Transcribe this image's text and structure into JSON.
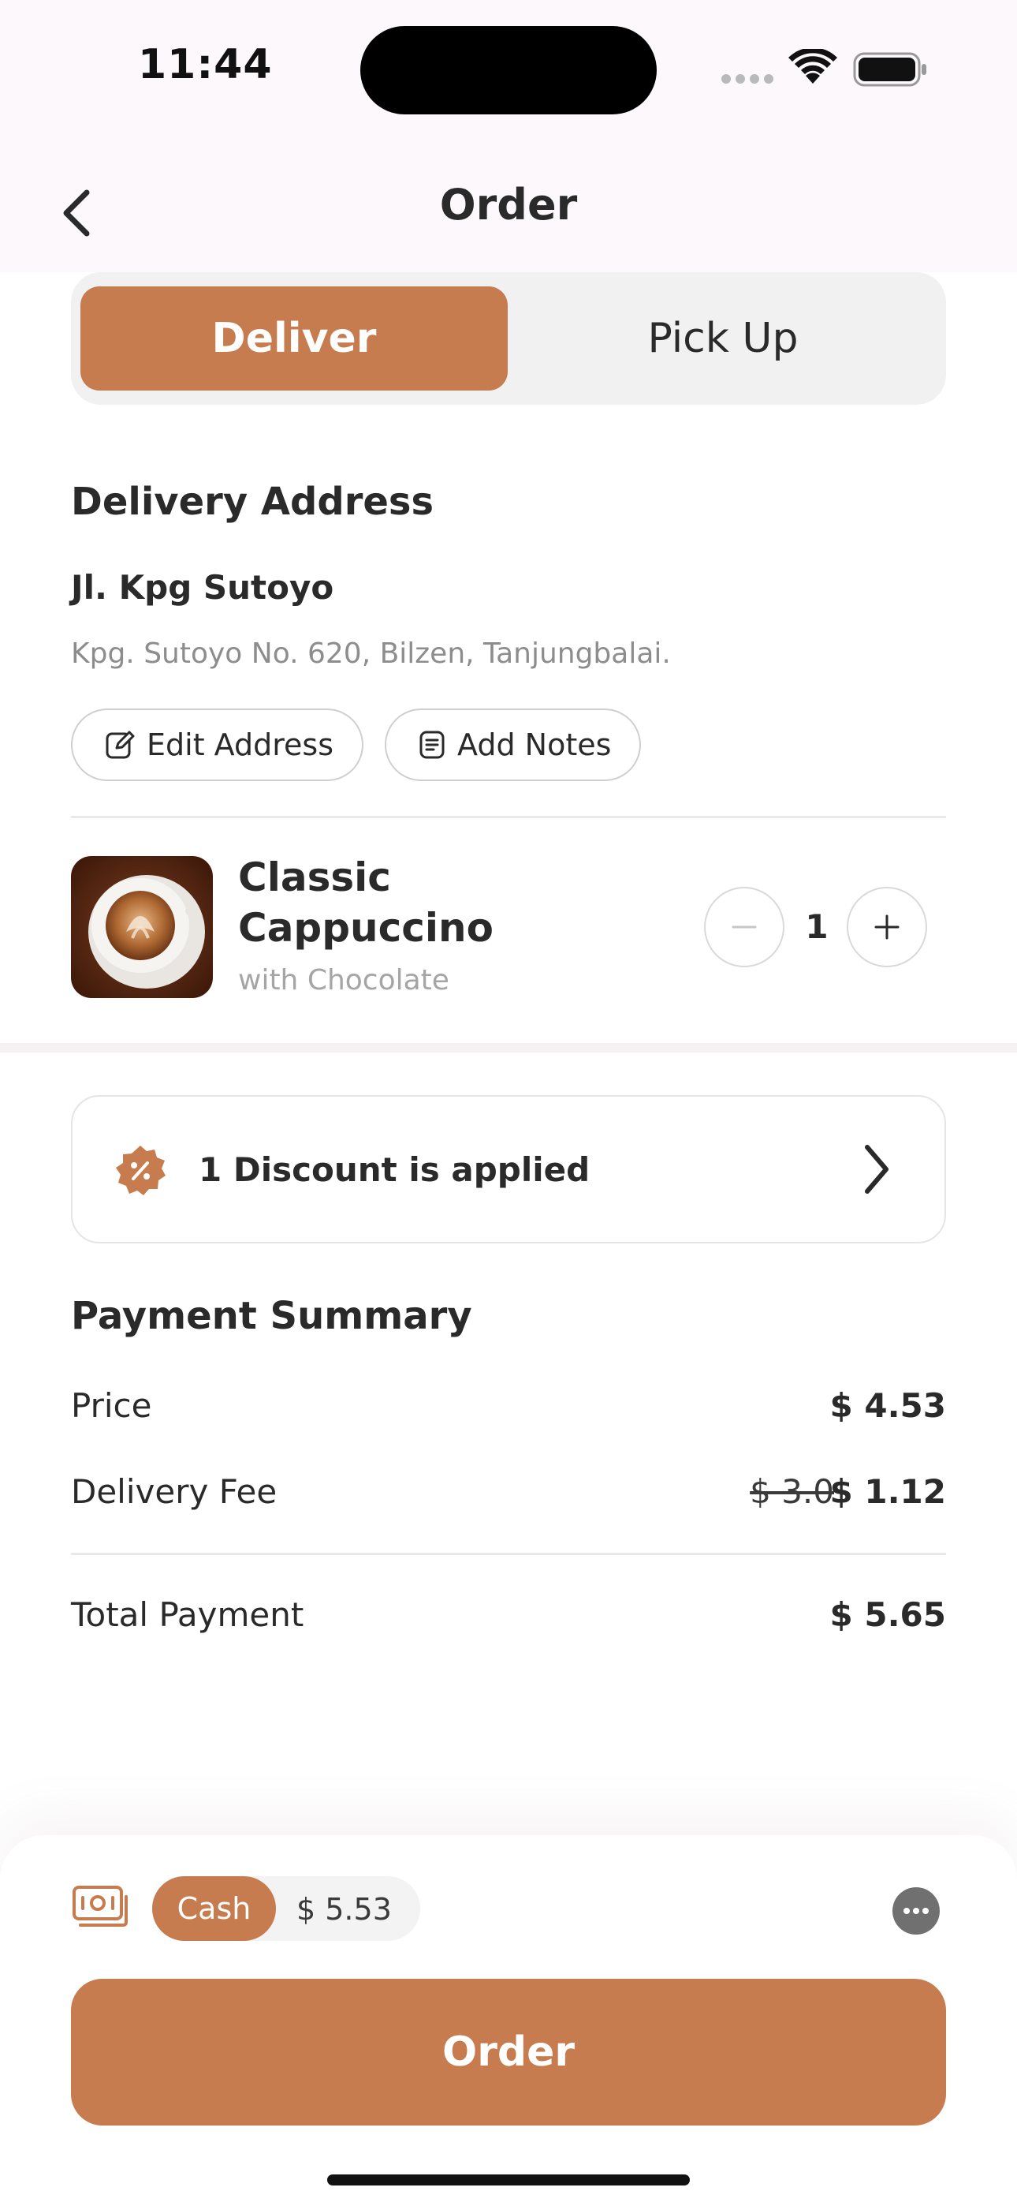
{
  "status_bar": {
    "time": "11:44"
  },
  "header": {
    "title": "Order"
  },
  "toggle": {
    "deliver_label": "Deliver",
    "pickup_label": "Pick Up"
  },
  "delivery": {
    "section_title": "Delivery Address",
    "address_name": "Jl. Kpg Sutoyo",
    "address_detail": "Kpg. Sutoyo No. 620, Bilzen, Tanjungbalai.",
    "edit_label": "Edit Address",
    "notes_label": "Add Notes"
  },
  "product": {
    "name": "Classic Cappuccino",
    "subtitle": "with Chocolate",
    "quantity": "1"
  },
  "discount": {
    "label": "1 Discount is applied"
  },
  "summary": {
    "title": "Payment Summary",
    "price_label": "Price",
    "price_value": "$ 4.53",
    "delivery_label": "Delivery Fee",
    "delivery_old": "$ 3.0",
    "delivery_value": "$ 1.12",
    "total_label": "Total Payment",
    "total_value": "$ 5.65"
  },
  "payment": {
    "method": "Cash",
    "amount": "$ 5.53"
  },
  "order_button": {
    "label": "Order"
  },
  "colors": {
    "accent": "#c67c4e",
    "header_bg": "#fdf8fb",
    "text": "#2a2a2a",
    "muted": "#8d8d8d"
  },
  "icons": [
    "back-icon",
    "wifi-icon",
    "battery-icon",
    "edit-icon",
    "notes-icon",
    "minus-icon",
    "plus-icon",
    "discount-icon",
    "chevron-right-icon",
    "wallet-icon",
    "more-icon"
  ]
}
